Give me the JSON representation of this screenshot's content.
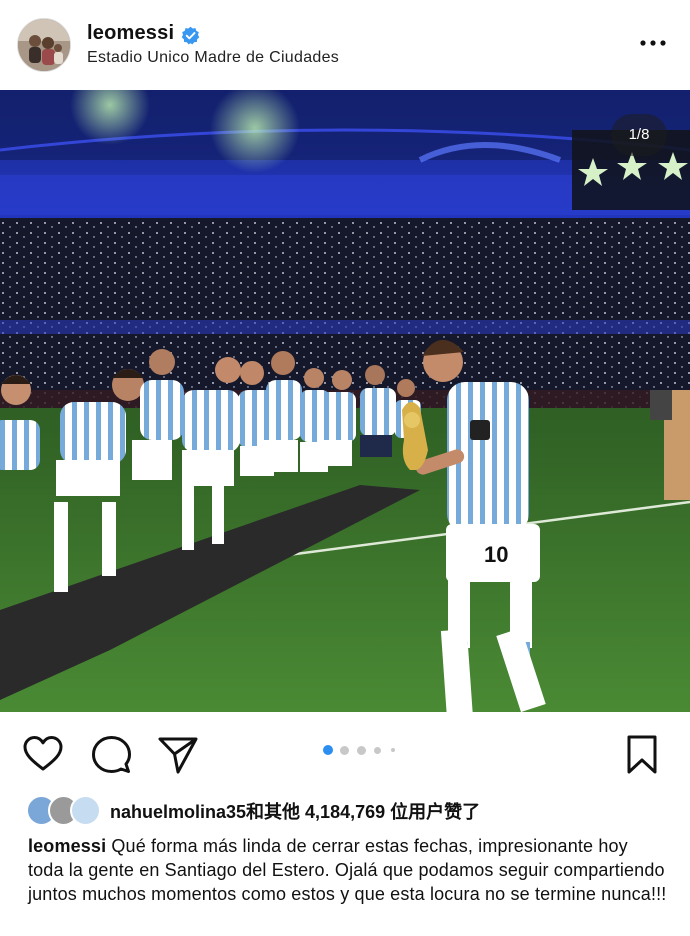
{
  "post": {
    "username": "leomessi",
    "location": "Estadio Unico Madre de Ciudades",
    "image_counter": "1/8",
    "jersey_number": "10"
  },
  "likes": {
    "user": "nahuelmolina35",
    "text": "和其他 4,184,769 位用户赞了"
  },
  "caption": {
    "username": "leomessi",
    "text": "Qué forma más linda de cerrar estas fechas, impresionante hoy toda la gente en Santiago del Estero. Ojalá que podamos seguir compartiendo juntos muchos momentos como estos y que esta locura no se termine nunca!!!"
  },
  "carousel": {
    "total_visible_dots": 5,
    "active_index": 0
  },
  "colors": {
    "verified": "#3897f0",
    "active_dot": "#2b8ef0",
    "pitch": "#3f7a2e",
    "stadium_lights": "#2438c8",
    "argentina_sky_blue": "#75aadb"
  },
  "icons": {
    "like": "heart-icon",
    "comment": "comment-icon",
    "share": "send-icon",
    "save": "bookmark-icon",
    "more": "more-options-icon",
    "verified": "verified-badge-icon"
  }
}
